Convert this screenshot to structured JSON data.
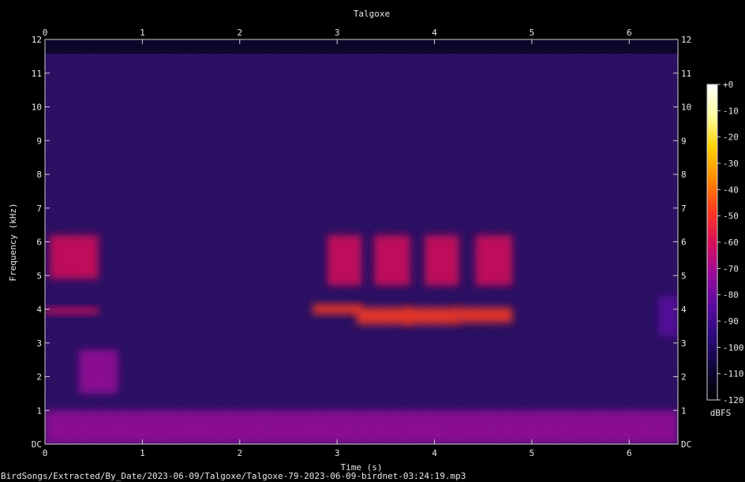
{
  "chart_data": {
    "type": "heatmap",
    "title": "Talgoxe",
    "xlabel": "Time (s)",
    "ylabel": "Frequency (kHz)",
    "xlim": [
      0,
      6.5
    ],
    "ylim": [
      0,
      12
    ],
    "x_ticks": [
      "0",
      "1",
      "2",
      "3",
      "4",
      "5",
      "6"
    ],
    "y_ticks": [
      "DC",
      "1",
      "2",
      "3",
      "4",
      "5",
      "6",
      "7",
      "8",
      "9",
      "10",
      "11",
      "12"
    ],
    "colorbar": {
      "label": "dBFS",
      "ticks": [
        "+0",
        "-10",
        "-20",
        "-30",
        "-40",
        "-50",
        "-60",
        "-70",
        "-80",
        "-90",
        "-100",
        "-110",
        "-120"
      ],
      "range": [
        -120,
        0
      ],
      "colors": [
        "#000000",
        "#0d0638",
        "#2a0a7a",
        "#5a0aa0",
        "#9a0a9a",
        "#d8105a",
        "#ff3a20",
        "#ff8a00",
        "#ffd200",
        "#ffffa0",
        "#ffffff"
      ]
    },
    "background_level_dbfs": -95,
    "features": [
      {
        "t0": 0.05,
        "t1": 0.55,
        "f0": 4.9,
        "f1": 6.2,
        "peak_dbfs": -55
      },
      {
        "t0": 0.0,
        "t1": 0.55,
        "f0": 3.85,
        "f1": 4.05,
        "peak_dbfs": -60
      },
      {
        "t0": 0.35,
        "t1": 0.75,
        "f0": 1.5,
        "f1": 2.8,
        "peak_dbfs": -75
      },
      {
        "t0": 2.9,
        "t1": 3.25,
        "f0": 4.7,
        "f1": 6.2,
        "peak_dbfs": -55
      },
      {
        "t0": 2.75,
        "t1": 3.25,
        "f0": 3.85,
        "f1": 4.15,
        "peak_dbfs": -50
      },
      {
        "t0": 3.38,
        "t1": 3.75,
        "f0": 4.7,
        "f1": 6.2,
        "peak_dbfs": -55
      },
      {
        "t0": 3.2,
        "t1": 3.75,
        "f0": 3.55,
        "f1": 4.05,
        "peak_dbfs": -50
      },
      {
        "t0": 3.9,
        "t1": 4.25,
        "f0": 4.7,
        "f1": 6.2,
        "peak_dbfs": -55
      },
      {
        "t0": 3.7,
        "t1": 4.25,
        "f0": 3.55,
        "f1": 4.05,
        "peak_dbfs": -50
      },
      {
        "t0": 4.42,
        "t1": 4.8,
        "f0": 4.7,
        "f1": 6.2,
        "peak_dbfs": -55
      },
      {
        "t0": 4.22,
        "t1": 4.8,
        "f0": 3.6,
        "f1": 4.05,
        "peak_dbfs": -50
      },
      {
        "t0": 6.3,
        "t1": 6.5,
        "f0": 3.2,
        "f1": 4.4,
        "peak_dbfs": -80
      },
      {
        "t0": 0.0,
        "t1": 6.5,
        "f0": 0.0,
        "f1": 1.0,
        "peak_dbfs": -75
      }
    ]
  },
  "footer": {
    "path": "BirdSongs/Extracted/By_Date/2023-06-09/Talgoxe/Talgoxe-79-2023-06-09-birdnet-03:24:19.mp3"
  }
}
